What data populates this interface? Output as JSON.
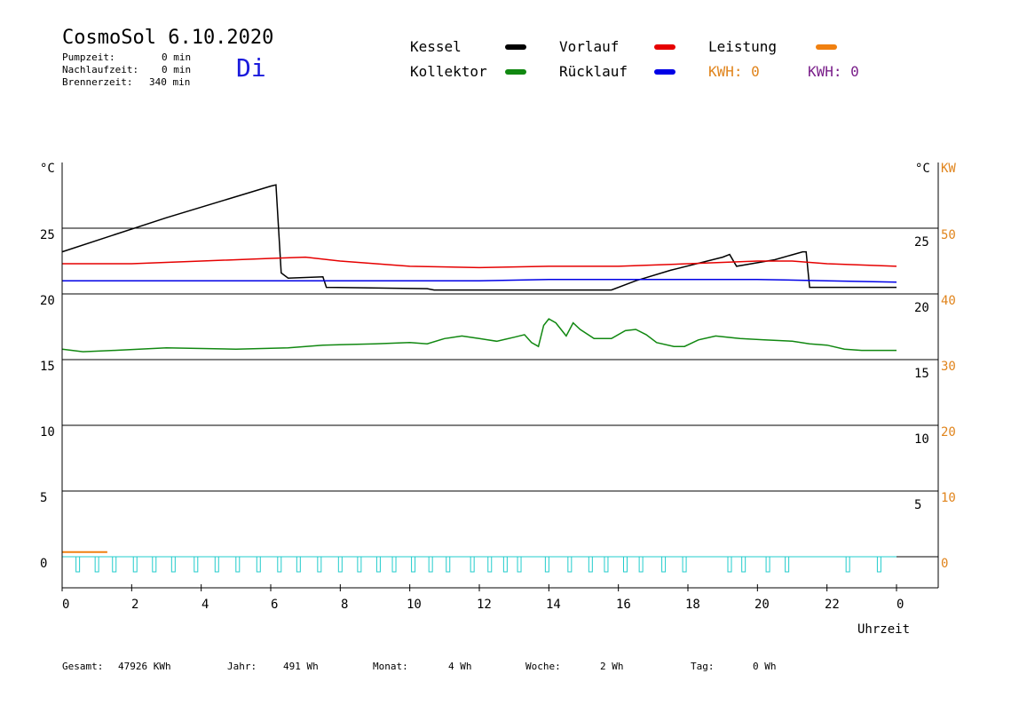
{
  "header": {
    "title": "CosmoSol 6.10.2020",
    "weekday": "Di",
    "stats": [
      {
        "label": "Pumpzeit:",
        "value": "0 min"
      },
      {
        "label": "Nachlaufzeit:",
        "value": "0 min"
      },
      {
        "label": "Brennerzeit:",
        "value": "340 min"
      }
    ]
  },
  "legend": {
    "items": [
      {
        "label": "Kessel",
        "color": "#000000"
      },
      {
        "label": "Vorlauf",
        "color": "#e60000"
      },
      {
        "label": "Leistung",
        "color": "#f08010"
      },
      {
        "label": "Kollektor",
        "color": "#118811"
      },
      {
        "label": "Rücklauf",
        "color": "#0000e6"
      }
    ],
    "kwh_orange": "KWH: 0",
    "kwh_purple": "KWH: 0"
  },
  "axes": {
    "left_unit": "°C",
    "right_unit": "°C",
    "right2_unit": "KW",
    "left_ticks": [
      "25",
      "20",
      "15",
      "10",
      "5",
      "0"
    ],
    "right_ticks": [
      "25",
      "20",
      "15",
      "10",
      "5"
    ],
    "kw_ticks": [
      "50",
      "40",
      "30",
      "20",
      "10",
      "0"
    ],
    "x_ticks": [
      "0",
      "2",
      "4",
      "6",
      "8",
      "10",
      "12",
      "14",
      "16",
      "18",
      "20",
      "22",
      "0"
    ],
    "x_label": "Uhrzeit"
  },
  "footer": {
    "items": [
      {
        "label": "Gesamt:",
        "value": "47926 KWh"
      },
      {
        "label": "Jahr:",
        "value": "491 Wh"
      },
      {
        "label": "Monat:",
        "value": "4 Wh"
      },
      {
        "label": "Woche:",
        "value": "2 Wh"
      },
      {
        "label": "Tag:",
        "value": "0 Wh"
      }
    ]
  },
  "chart_data": {
    "type": "line",
    "xlabel": "Uhrzeit",
    "ylabel": "°C",
    "y2label": "KW",
    "xlim": [
      0,
      24
    ],
    "ylim": [
      0,
      30
    ],
    "y2lim": [
      0,
      60
    ],
    "grid": "horizontal",
    "series": [
      {
        "name": "Kessel",
        "color": "#000000",
        "points": [
          [
            0,
            23.2
          ],
          [
            3,
            25.8
          ],
          [
            6,
            28.2
          ],
          [
            6.15,
            28.3
          ],
          [
            6.3,
            21.6
          ],
          [
            6.5,
            21.2
          ],
          [
            7.5,
            21.3
          ],
          [
            7.6,
            20.5
          ],
          [
            10.5,
            20.4
          ],
          [
            10.7,
            20.3
          ],
          [
            15.8,
            20.3
          ],
          [
            16.5,
            21.0
          ],
          [
            17.5,
            21.8
          ],
          [
            19,
            22.8
          ],
          [
            19.2,
            23.0
          ],
          [
            19.4,
            22.1
          ],
          [
            20.5,
            22.6
          ],
          [
            21.3,
            23.2
          ],
          [
            21.4,
            23.2
          ],
          [
            21.5,
            20.5
          ],
          [
            24,
            20.5
          ]
        ]
      },
      {
        "name": "Vorlauf",
        "color": "#e60000",
        "points": [
          [
            0,
            22.3
          ],
          [
            2,
            22.3
          ],
          [
            4,
            22.5
          ],
          [
            6,
            22.7
          ],
          [
            7,
            22.8
          ],
          [
            8,
            22.5
          ],
          [
            10,
            22.1
          ],
          [
            12,
            22.0
          ],
          [
            14,
            22.1
          ],
          [
            16,
            22.1
          ],
          [
            18,
            22.3
          ],
          [
            20,
            22.5
          ],
          [
            21,
            22.5
          ],
          [
            22,
            22.3
          ],
          [
            24,
            22.1
          ]
        ]
      },
      {
        "name": "Kollektor",
        "color": "#118811",
        "points": [
          [
            0,
            15.8
          ],
          [
            0.6,
            15.6
          ],
          [
            1.5,
            15.7
          ],
          [
            3,
            15.9
          ],
          [
            5,
            15.8
          ],
          [
            6.5,
            15.9
          ],
          [
            7.5,
            16.1
          ],
          [
            9,
            16.2
          ],
          [
            10,
            16.3
          ],
          [
            10.5,
            16.2
          ],
          [
            11,
            16.6
          ],
          [
            11.5,
            16.8
          ],
          [
            12,
            16.6
          ],
          [
            12.5,
            16.4
          ],
          [
            13,
            16.7
          ],
          [
            13.3,
            16.9
          ],
          [
            13.5,
            16.3
          ],
          [
            13.7,
            16.0
          ],
          [
            13.85,
            17.6
          ],
          [
            14.0,
            18.1
          ],
          [
            14.2,
            17.8
          ],
          [
            14.5,
            16.8
          ],
          [
            14.7,
            17.8
          ],
          [
            14.9,
            17.3
          ],
          [
            15.3,
            16.6
          ],
          [
            15.8,
            16.6
          ],
          [
            16.2,
            17.2
          ],
          [
            16.5,
            17.3
          ],
          [
            16.8,
            16.9
          ],
          [
            17.1,
            16.3
          ],
          [
            17.6,
            16.0
          ],
          [
            17.9,
            16.0
          ],
          [
            18.3,
            16.5
          ],
          [
            18.8,
            16.8
          ],
          [
            19.5,
            16.6
          ],
          [
            20.2,
            16.5
          ],
          [
            21,
            16.4
          ],
          [
            21.5,
            16.2
          ],
          [
            22,
            16.1
          ],
          [
            22.5,
            15.8
          ],
          [
            23,
            15.7
          ],
          [
            24,
            15.7
          ]
        ]
      },
      {
        "name": "Rücklauf",
        "color": "#0000e6",
        "points": [
          [
            0,
            21.0
          ],
          [
            4,
            21.0
          ],
          [
            6,
            21.0
          ],
          [
            8,
            21.0
          ],
          [
            10,
            21.0
          ],
          [
            12,
            21.0
          ],
          [
            14,
            21.1
          ],
          [
            16,
            21.1
          ],
          [
            18,
            21.1
          ],
          [
            20,
            21.1
          ],
          [
            22,
            21.0
          ],
          [
            24,
            20.9
          ]
        ]
      },
      {
        "name": "Leistung",
        "color": "#f08010",
        "points": [
          [
            0,
            0.35
          ],
          [
            1.3,
            0.35
          ]
        ]
      }
    ],
    "pump_pulses_h": [
      0.45,
      1.0,
      1.5,
      2.1,
      2.65,
      3.2,
      3.85,
      4.45,
      5.05,
      5.65,
      6.25,
      6.8,
      7.4,
      8.0,
      8.55,
      9.1,
      9.55,
      10.1,
      10.6,
      11.1,
      11.8,
      12.3,
      12.75,
      13.15,
      13.95,
      14.6,
      15.2,
      15.65,
      16.2,
      16.65,
      17.3,
      17.9,
      19.2,
      19.6,
      20.3,
      20.85,
      22.6,
      23.5
    ]
  }
}
